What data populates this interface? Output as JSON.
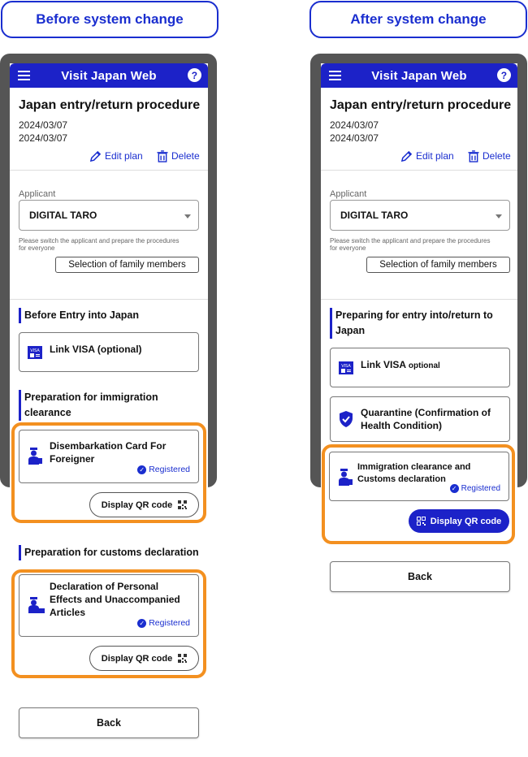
{
  "before": {
    "heading": "Before system change",
    "app_title": "Visit Japan Web",
    "help_icon": "?",
    "page_title": "Japan entry/return procedure",
    "date1": "2024/03/07",
    "date2": "2024/03/07",
    "edit_plan": "Edit plan",
    "delete": "Delete",
    "applicant_label": "Applicant",
    "applicant_value": "DIGITAL TARO",
    "hint": "Please switch the applicant and prepare the procedures for everyone",
    "family_button": "Selection of family members",
    "section1": "Before Entry into Japan",
    "visa_card": "Link VISA (optional)",
    "section2": "Preparation for immigration clearance",
    "immigration_card": "Disembarkation Card For Foreigner",
    "registered": "Registered",
    "qr_button": "Display QR code",
    "section3": "Preparation for customs declaration",
    "customs_card": "Declaration of Personal Effects and Unaccompanied Articles",
    "registered2": "Registered",
    "qr_button2": "Display QR code",
    "back": "Back"
  },
  "after": {
    "heading": "After system change",
    "app_title": "Visit Japan Web",
    "help_icon": "?",
    "page_title": "Japan entry/return procedure",
    "date1": "2024/03/07",
    "date2": "2024/03/07",
    "edit_plan": "Edit plan",
    "delete": "Delete",
    "applicant_label": "Applicant",
    "applicant_value": "DIGITAL TARO",
    "hint": "Please switch the applicant and prepare the procedures for everyone",
    "family_button": "Selection of family members",
    "section1": "Preparing for entry into/return to Japan",
    "visa_card": "Link VISA",
    "visa_optional": "optional",
    "quarantine_card": "Quarantine (Confirmation of Health Condition)",
    "immigration_customs_card": "Immigration clearance and Customs declaration",
    "registered": "Registered",
    "qr_button": "Display QR code",
    "back": "Back"
  },
  "colors": {
    "accent": "#1c22c8",
    "highlight": "#f39020",
    "frame": "#555555"
  }
}
